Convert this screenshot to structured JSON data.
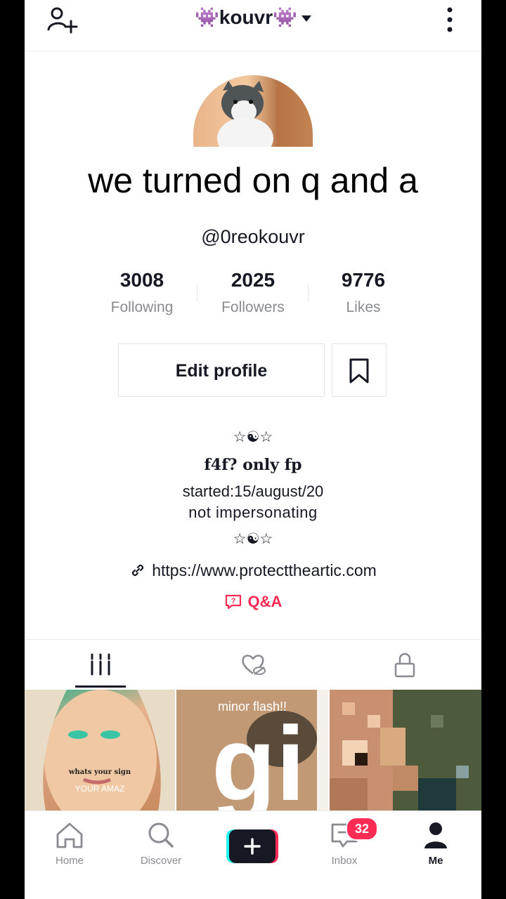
{
  "header": {
    "title_prefix": "👾",
    "title": "kouvr",
    "title_suffix": "👾",
    "add_user_icon": "add-user-icon",
    "more_icon": "more-vertical-icon"
  },
  "profile": {
    "overlay_caption": "we turned on q and a",
    "username": "@0reokouvr",
    "stats": [
      {
        "value": "3008",
        "label": "Following"
      },
      {
        "value": "2025",
        "label": "Followers"
      },
      {
        "value": "9776",
        "label": "Likes"
      }
    ],
    "edit_label": "Edit profile",
    "bio": {
      "line1": "☆☯☆",
      "line2": "f4f? only fp",
      "line3": "started:15/august/20",
      "line4": "not impersonating",
      "line5": "☆☯☆"
    },
    "link": "https://www.protecttheartic.com",
    "qa_label": "Q&A"
  },
  "tabs": [
    {
      "icon": "grid-icon",
      "active": true
    },
    {
      "icon": "liked-hidden-icon",
      "active": false
    },
    {
      "icon": "lock-icon",
      "active": false
    }
  ],
  "videos": [
    {
      "caption": "whats your sign",
      "subcaption": "YOUR AMAZ"
    },
    {
      "caption": "minor flash!!",
      "big_text": "gi"
    },
    {
      "caption": ""
    }
  ],
  "nav": {
    "home": "Home",
    "discover": "Discover",
    "inbox": "Inbox",
    "inbox_badge": "32",
    "me": "Me"
  },
  "colors": {
    "accent": "#fe2c55",
    "cyan": "#25f4ee",
    "text": "#161823",
    "muted": "#8a8b91"
  }
}
